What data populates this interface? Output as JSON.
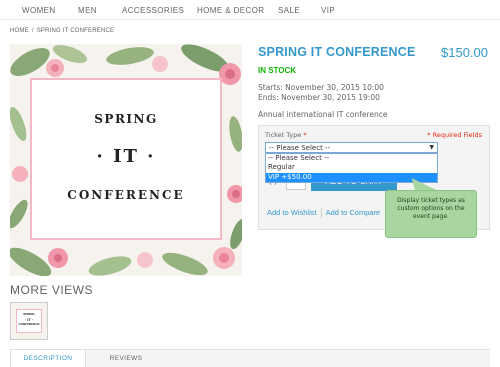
{
  "nav": {
    "items": [
      "WOMEN",
      "MEN",
      "ACCESSORIES",
      "HOME & DECOR",
      "SALE",
      "VIP"
    ]
  },
  "breadcrumb": {
    "home": "HOME",
    "separator": "/",
    "current": "SPRING IT CONFERENCE"
  },
  "product_image": {
    "line1": "SPRING",
    "line2": "· IT ·",
    "line3": "CONFERENCE"
  },
  "product": {
    "title": "SPRING IT CONFERENCE",
    "price": "$150.00",
    "stock": "IN STOCK",
    "starts": "Starts: November 30, 2015 10:00",
    "ends": "Ends: November 30, 2015 19:00",
    "description": "Annual international IT conference"
  },
  "options": {
    "label": "Ticket Type",
    "required_mark": "*",
    "required_note": "* Required Fields",
    "select_value": "-- Please Select --",
    "dropdown_options": [
      "-- Please Select --",
      "Regular",
      "VIP +$50.00"
    ],
    "selected_index": 2
  },
  "cart": {
    "qty_label": "Qty",
    "qty_value": "1",
    "add_to_cart": "ADD TO CART"
  },
  "actions": {
    "wishlist": "Add to Wishlist",
    "compare": "Add to Compare"
  },
  "tooltip": {
    "text": "Display ticket types as custom options on the event page."
  },
  "more_views": {
    "heading": "MORE VIEWS",
    "thumb_line1": "SPRING",
    "thumb_line2": "· IT ·",
    "thumb_line3": "CONFERENCE"
  },
  "tabs": {
    "description": "DESCRIPTION",
    "reviews": "REVIEWS"
  },
  "colors": {
    "accent": "#3399cc",
    "stock": "#11b400",
    "required": "#df280a",
    "tooltip_bg": "#a8d5a0",
    "card_border": "#f2b8c6"
  }
}
